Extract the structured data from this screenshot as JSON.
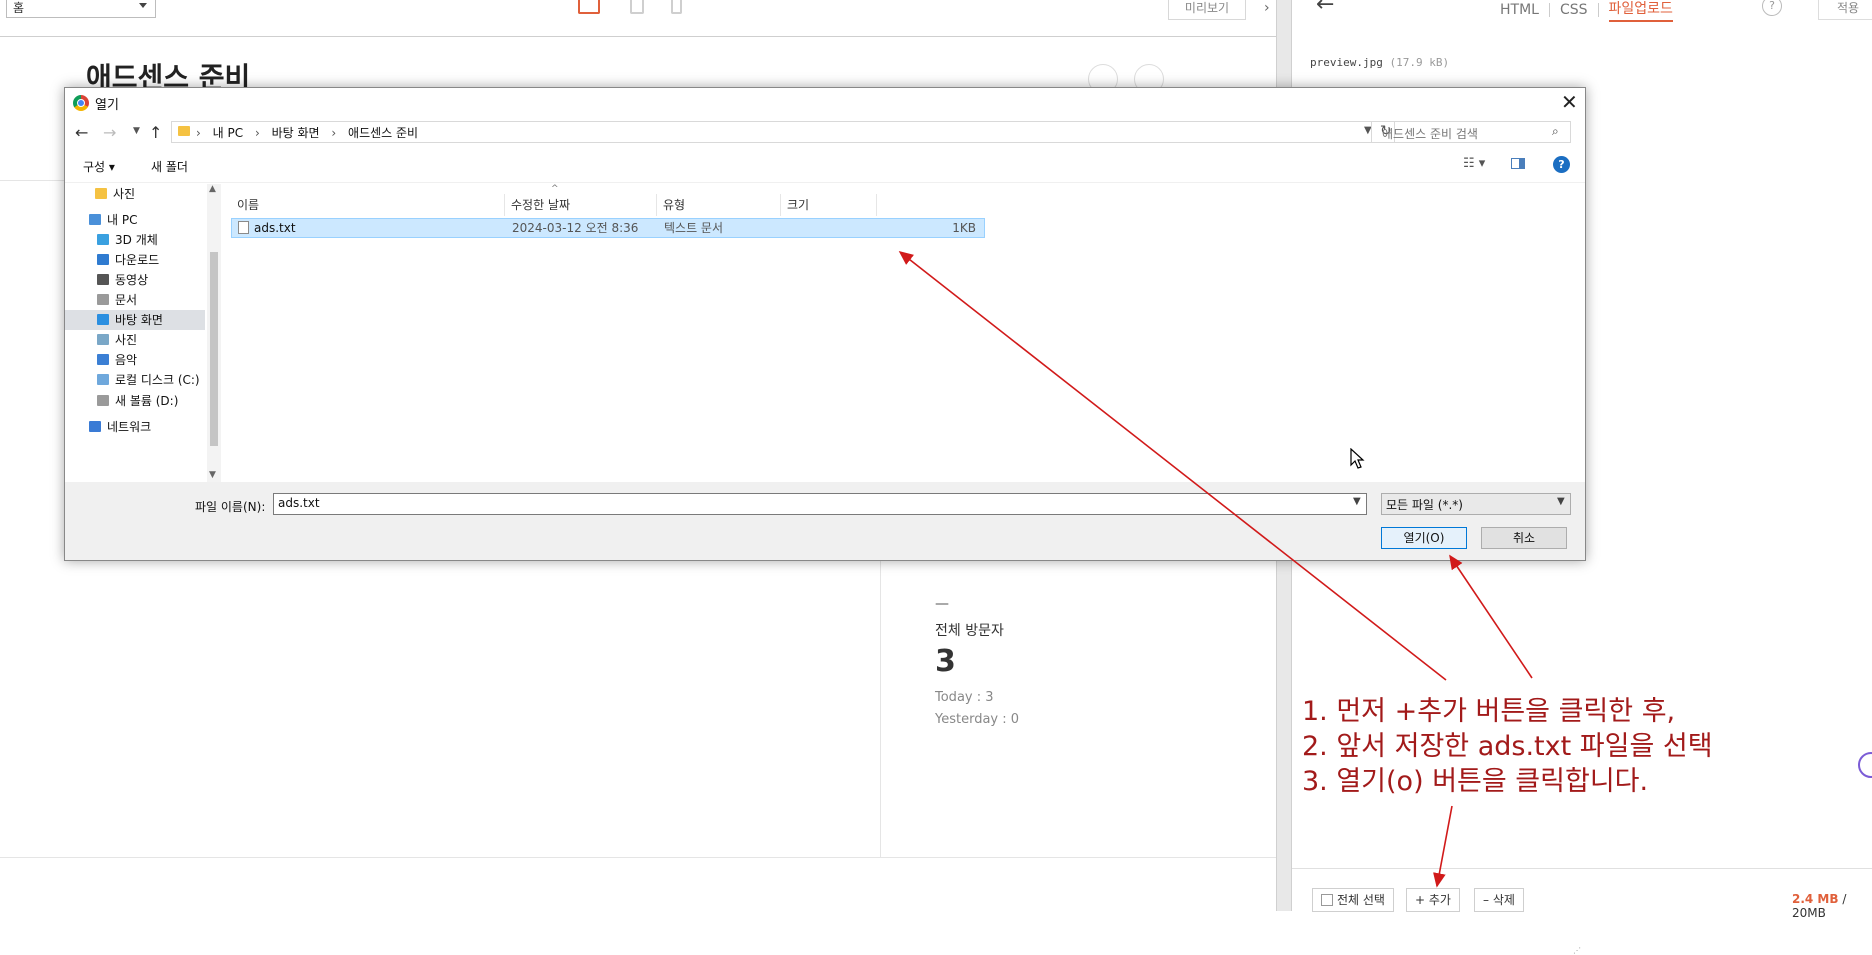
{
  "editor": {
    "page_select": "홈",
    "preview_label": "미리보기",
    "canvas_title": "애드센스 준비",
    "visitor": {
      "dash": "—",
      "label": "전체 방문자",
      "total": "3",
      "today": "Today : 3",
      "yesterday": "Yesterday : 0"
    }
  },
  "right_panel": {
    "tabs": [
      "HTML",
      "CSS",
      "파일업로드"
    ],
    "active_tab": "파일업로드",
    "help": "?",
    "apply_label": "적용",
    "file_name": "preview.jpg",
    "file_size": "(17.9 kB)",
    "select_all_label": "전체 선택",
    "add_label": "+ 추가",
    "delete_label": "– 삭제",
    "storage_used": "2.4 MB",
    "storage_total": " / 20MB"
  },
  "dialog": {
    "title": "열기",
    "close": "✕",
    "path": [
      "내 PC",
      "바탕 화면",
      "애드센스 준비"
    ],
    "search_placeholder": "애드센스 준비 검색",
    "toolbar": {
      "organize": "구성 ▾",
      "new_folder": "새 폴더",
      "view": "☷ ▾",
      "help": "?"
    },
    "nav_items": [
      {
        "label": "사진",
        "icon": "folder-icon",
        "color": "#f5c242"
      },
      {
        "label": "내 PC",
        "icon": "pc-icon",
        "color": "#4a90d9"
      },
      {
        "label": "3D 개체",
        "icon": "cube-icon",
        "color": "#3aa0e0"
      },
      {
        "label": "다운로드",
        "icon": "download-icon",
        "color": "#2f7bd0"
      },
      {
        "label": "동영상",
        "icon": "video-icon",
        "color": "#555555"
      },
      {
        "label": "문서",
        "icon": "document-icon",
        "color": "#9a9a9a"
      },
      {
        "label": "바탕 화면",
        "icon": "desktop-icon",
        "color": "#2b8fe0"
      },
      {
        "label": "사진",
        "icon": "picture-icon",
        "color": "#7aa7c7"
      },
      {
        "label": "음악",
        "icon": "music-icon",
        "color": "#3b7fd4"
      },
      {
        "label": "로컬 디스크 (C:)",
        "icon": "drive-icon",
        "color": "#6fa8dc"
      },
      {
        "label": "새 볼륨 (D:)",
        "icon": "drive-icon",
        "color": "#9a9a9a"
      },
      {
        "label": "네트워크",
        "icon": "network-icon",
        "color": "#3a7bd5"
      }
    ],
    "selected_nav": "바탕 화면",
    "columns": [
      "이름",
      "수정한 날짜",
      "유형",
      "크기"
    ],
    "files": [
      {
        "name": "ads.txt",
        "modified": "2024-03-12 오전 8:36",
        "type": "텍스트 문서",
        "size": "1KB"
      }
    ],
    "file_name_label": "파일 이름(N):",
    "file_name_value": "ads.txt",
    "file_type": "모든 파일 (*.*)",
    "open_label": "열기(O)",
    "cancel_label": "취소"
  },
  "annotation": {
    "lines": [
      "1. 먼저 +추가 버튼을 클릭한 후,",
      "2. 앞서 저장한 ads.txt 파일을 선택",
      "3. 열기(o) 버튼을 클릭합니다."
    ],
    "color": "#d11a1a"
  }
}
